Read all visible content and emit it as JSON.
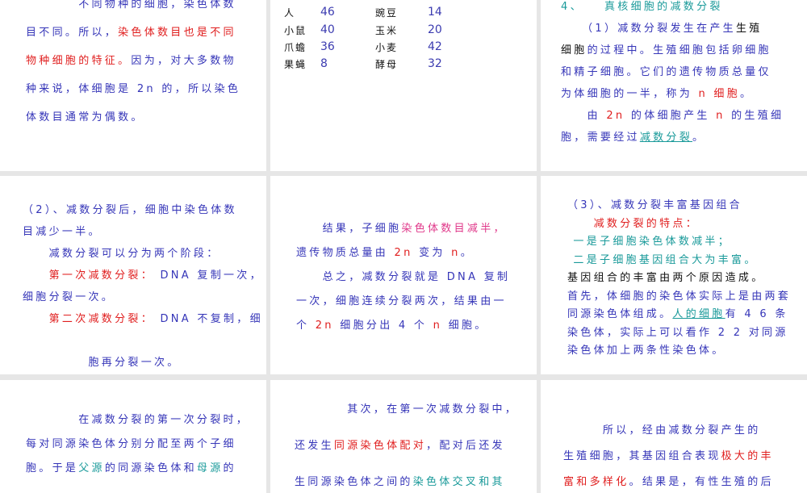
{
  "colors": {
    "b": "#3535b8",
    "r": "#e01e1e",
    "t": "#1a9a9a",
    "k": "#111111",
    "p": "#e0388a"
  },
  "slides": [
    {
      "id": "s1",
      "lines": [
        [
          [
            "　　　　不同物种的细胞，染色体数",
            "b"
          ]
        ],
        [
          [
            "目不同。所以，",
            "b"
          ],
          [
            "染色体数目也是不同",
            "r"
          ]
        ],
        [
          [
            "物种细胞的特征。",
            "r"
          ],
          [
            "因为，对大多数物",
            "b"
          ]
        ],
        [
          [
            "种来说，体细胞是 2n 的，所以染色",
            "b"
          ]
        ],
        [
          [
            "体数目通常为偶数。",
            "b"
          ]
        ]
      ]
    },
    {
      "id": "s2",
      "table": [
        [
          "人",
          "46",
          "豌豆",
          "14"
        ],
        [
          "小鼠",
          "40",
          "玉米",
          "20"
        ],
        [
          "爪蟾",
          "36",
          "小麦",
          "42"
        ],
        [
          "果蝇",
          "8",
          "酵母",
          "32"
        ]
      ]
    },
    {
      "id": "s3",
      "lines": [
        [
          [
            "4、　　真核细胞的减数分裂",
            "t"
          ]
        ],
        [
          [
            "　　（1）减数分裂发生在产生",
            "b"
          ],
          [
            "生殖",
            "k"
          ]
        ],
        [
          [
            "细胞",
            "k"
          ],
          [
            "的过程中。生殖细胞包括卵细胞",
            "b"
          ]
        ],
        [
          [
            "和精子细胞。它们的遗传物质总量仅",
            "b"
          ]
        ],
        [
          [
            "为体细胞的一半，称为 ",
            "b"
          ],
          [
            "n 细胞",
            "r"
          ],
          [
            "。",
            "b"
          ]
        ],
        [
          [
            "　　由 ",
            "b"
          ],
          [
            "2n",
            "r"
          ],
          [
            " 的体细胞产生 ",
            "b"
          ],
          [
            "n",
            "r"
          ],
          [
            " 的生殖细",
            "b"
          ]
        ],
        [
          [
            "胞，需要经过",
            "b"
          ],
          [
            "减数分裂",
            "t",
            "u"
          ],
          [
            "。",
            "b"
          ]
        ]
      ]
    },
    {
      "id": "s4",
      "lines": [
        [
          [
            "（2）、减数分裂后，细胞中染色体数",
            "b"
          ]
        ],
        [
          [
            "目减少一半。",
            "b"
          ]
        ],
        [
          [
            "　　减数分裂可以分为两个阶段：",
            "b"
          ]
        ],
        [
          [
            "　　",
            "b"
          ],
          [
            "第一次减数分裂：",
            "r"
          ],
          [
            " DNA 复制一次，",
            "b"
          ]
        ],
        [
          [
            "细胞分裂一次。",
            "b"
          ]
        ],
        [
          [
            "　　",
            "b"
          ],
          [
            "第二次减数分裂：",
            "r"
          ],
          [
            " DNA 不复制，细",
            "b"
          ]
        ],
        [
          [
            "",
            "b"
          ]
        ],
        [
          [
            "　　　　　胞再分裂一次。",
            "b"
          ]
        ]
      ]
    },
    {
      "id": "s5",
      "lines": [
        [
          [
            "　　结果，子细胞",
            "b"
          ],
          [
            "染色体数目减半，",
            "p"
          ]
        ],
        [
          [
            "遗传物质总量由 ",
            "b"
          ],
          [
            "2n",
            "r"
          ],
          [
            " 变为 ",
            "b"
          ],
          [
            "n",
            "r"
          ],
          [
            "。",
            "b"
          ]
        ],
        [
          [
            "　　总之，减数分裂就是 DNA 复制",
            "b"
          ]
        ],
        [
          [
            "一次，细胞连续分裂两次，结果由一",
            "b"
          ]
        ],
        [
          [
            "个 ",
            "b"
          ],
          [
            "2n",
            "r"
          ],
          [
            " 细胞分出 4 个 ",
            "b"
          ],
          [
            "n",
            "r"
          ],
          [
            " 细胞。",
            "b"
          ]
        ]
      ]
    },
    {
      "id": "s6",
      "lines": [
        [
          [
            "（3）、减数分裂丰富基因组合",
            "b"
          ]
        ],
        [
          [
            "　　",
            "b"
          ],
          [
            "减数分裂的特点：",
            "r"
          ]
        ],
        [
          [
            " 一是子细胞染色体数减半；",
            "t"
          ]
        ],
        [
          [
            " 二是子细胞基因组合大为丰富。",
            "t"
          ]
        ],
        [
          [
            "基因组合的丰富由两个原因造成。",
            "k"
          ]
        ],
        [
          [
            "首先，体细胞的染色体实际上是由两套",
            "b"
          ]
        ],
        [
          [
            "同源染色体组成。",
            "b"
          ],
          [
            "人的细胞",
            "t",
            "u"
          ],
          [
            "有 4 6 条",
            "b"
          ]
        ],
        [
          [
            "染色体，实际上可以看作 2 2 对同源",
            "b"
          ]
        ],
        [
          [
            "染色体加上两条性染色体。",
            "b"
          ]
        ]
      ]
    },
    {
      "id": "s7",
      "lines": [
        [
          [
            "　　　　在减数分裂的第一次分裂时，",
            "b"
          ]
        ],
        [
          [
            "每对同源染色体分别分配至两个子细",
            "b"
          ]
        ],
        [
          [
            "胞。于是",
            "b"
          ],
          [
            "父源",
            "t"
          ],
          [
            "的同源染色体和",
            "b"
          ],
          [
            "母源",
            "t"
          ],
          [
            "的",
            "b"
          ]
        ]
      ]
    },
    {
      "id": "s8",
      "lines": [
        [
          [
            "　　　　其次，在第一次减数分裂中，",
            "b"
          ]
        ],
        [
          [
            "还发生",
            "b"
          ],
          [
            "同源染色体配对",
            "r"
          ],
          [
            "，配对后还发",
            "b"
          ]
        ],
        [
          [
            "生同源染色体之间的",
            "b"
          ],
          [
            "染色体交叉和其",
            "t"
          ]
        ]
      ]
    },
    {
      "id": "s9",
      "lines": [
        [
          [
            "　　　所以，经由减数分裂产生的",
            "b"
          ]
        ],
        [
          [
            "生殖细胞，其基因组合表现",
            "b"
          ],
          [
            "极大的丰",
            "r"
          ]
        ],
        [
          [
            "富和多样化",
            "r"
          ],
          [
            "。结果是，有性生殖的后",
            "b"
          ]
        ]
      ]
    }
  ]
}
